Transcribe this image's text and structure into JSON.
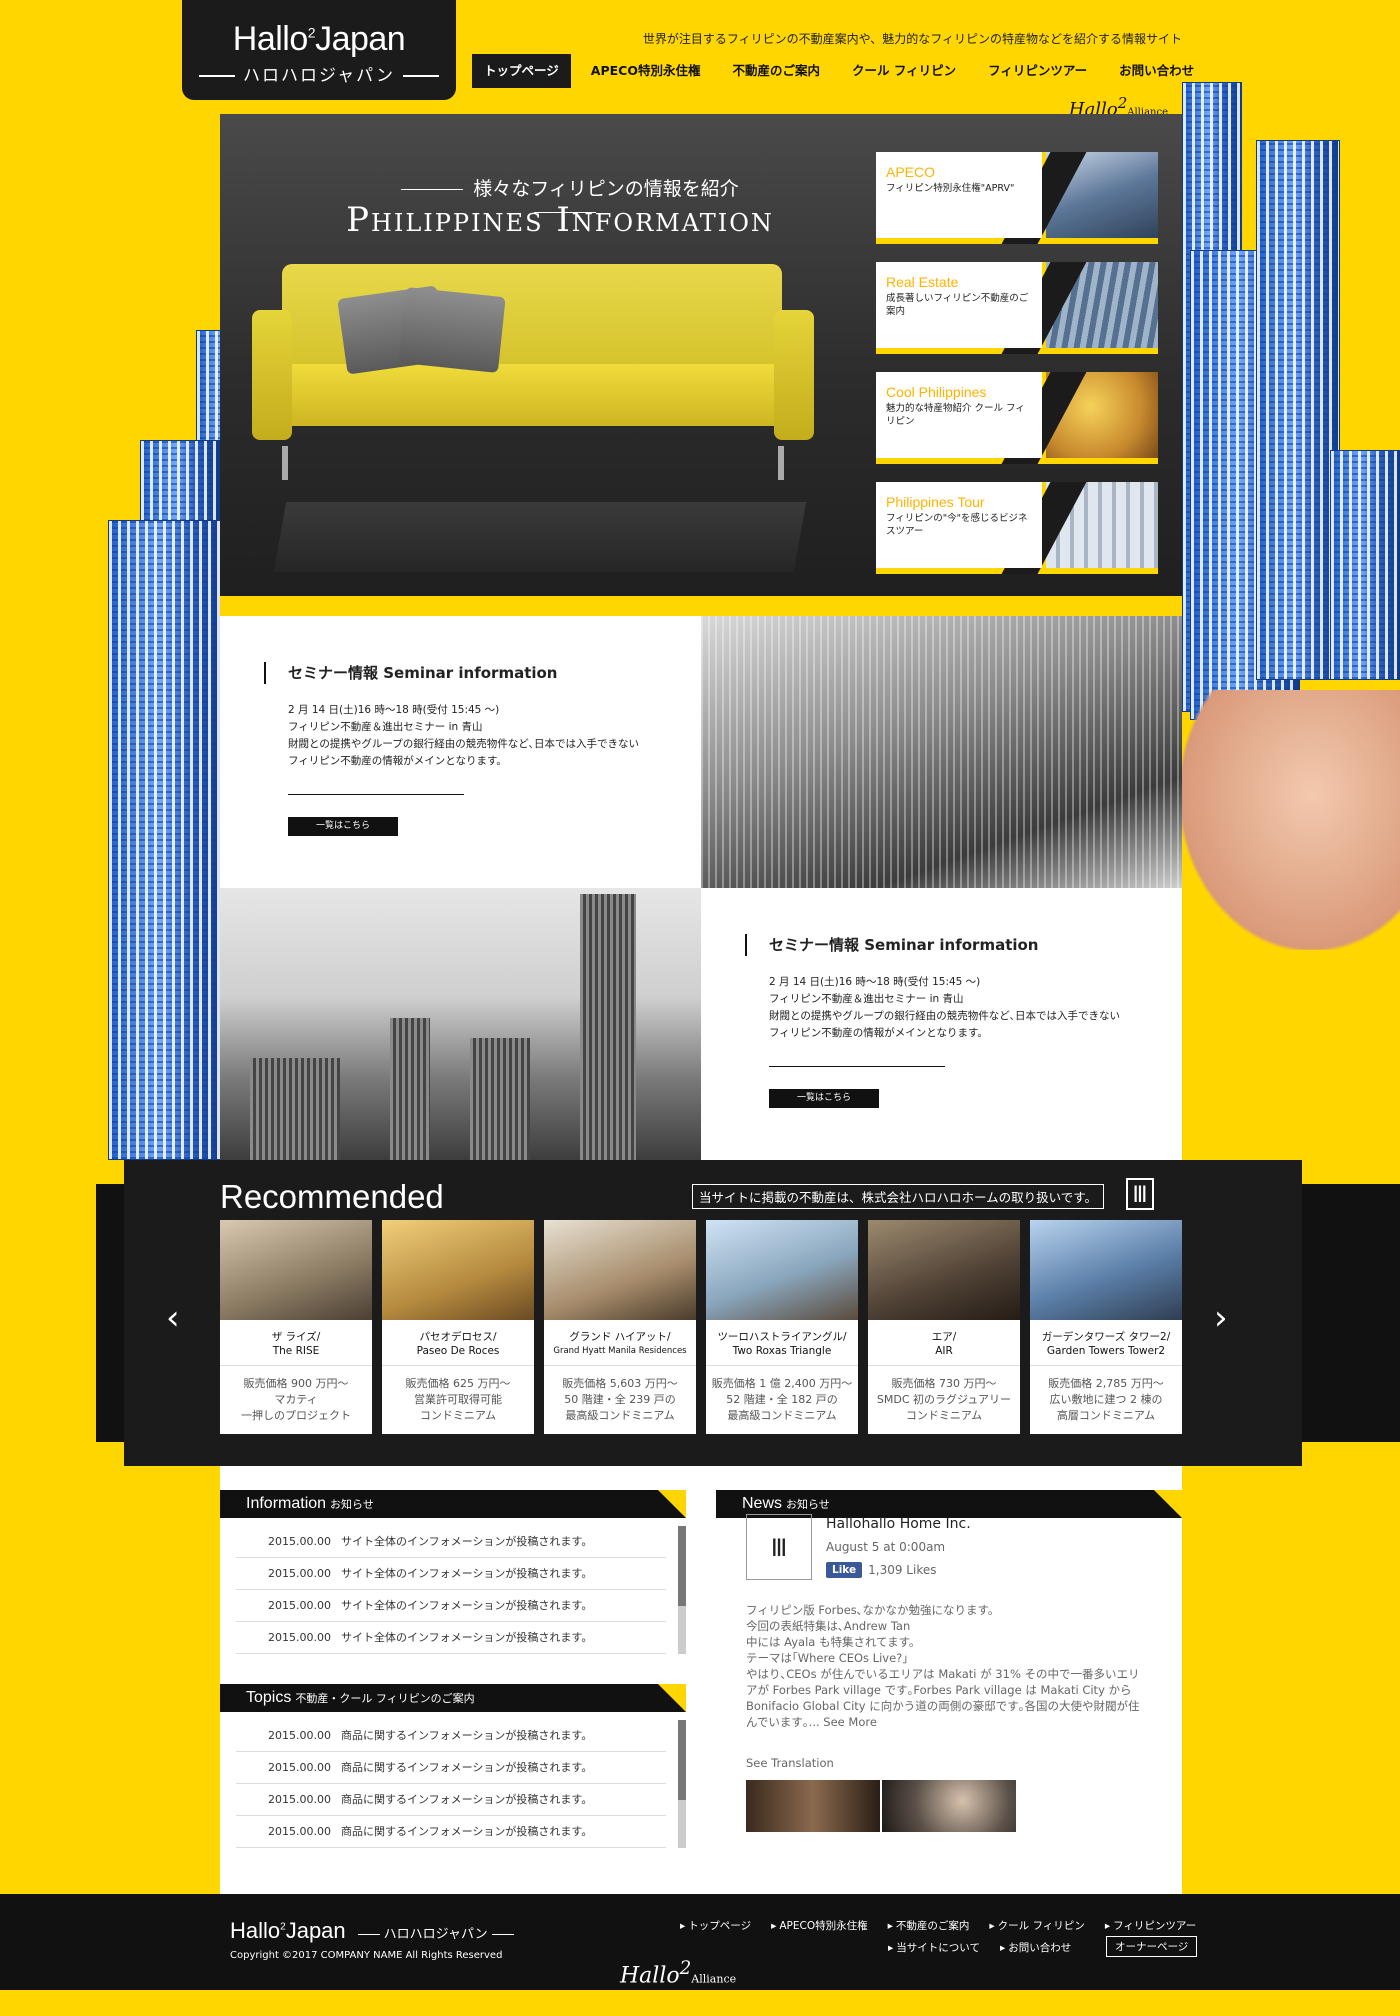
{
  "header": {
    "logo_main": "Hallo",
    "logo_sup": "2",
    "logo_rest": "Japan",
    "logo_sub": "ハロハロジャパン",
    "tagline": "世界が注目するフィリピンの不動産案内や、魅力的なフィリピンの特産物などを紹介する情報サイト",
    "nav": [
      "トップページ",
      "APECO特別永住権",
      "不動産のご案内",
      "クール フィリピン",
      "フィリピンツアー",
      "お問い合わせ"
    ],
    "alliance": "Hallo",
    "alliance_sup": "2",
    "alliance_word": "Alliance"
  },
  "hero": {
    "subtitle": "様々なフィリピンの情報を紹介",
    "title": "Philippines Information",
    "cards": [
      {
        "title": "APECO",
        "desc": "フィリピン特別永住権\"APRV\""
      },
      {
        "title": "Real Estate",
        "desc": "成長著しいフィリピン不動産のご案内"
      },
      {
        "title": "Cool Philippines",
        "desc": "魅力的な特産物紹介 クール フィリピン"
      },
      {
        "title": "Philippines Tour",
        "desc": "フィリピンの\"今\"を感じるビジネスツアー"
      }
    ]
  },
  "seminars": [
    {
      "heading": "セミナー情報 Seminar information",
      "lines": [
        "2 月 14 日(土)16 時〜18 時(受付 15:45 〜)",
        "フィリピン不動産＆進出セミナー in 青山",
        "財閥との提携やグループの銀行経由の競売物件など､日本では入手できない",
        "フィリピン不動産の情報がメインとなります。"
      ],
      "button": "一覧はこちら"
    },
    {
      "heading": "セミナー情報 Seminar information",
      "lines": [
        "2 月 14 日(土)16 時〜18 時(受付 15:45 〜)",
        "フィリピン不動産＆進出セミナー in 青山",
        "財閥との提携やグループの銀行経由の競売物件など､日本では入手できない",
        "フィリピン不動産の情報がメインとなります。"
      ],
      "button": "一覧はこちら"
    }
  ],
  "recommended": {
    "title": "Recommended",
    "note": "当サイトに掲載の不動産は、株式会社ハロハロホームの取り扱いです。",
    "prev": "‹",
    "next": "›",
    "items": [
      {
        "name1": "ザ ライズ/",
        "name2": "The RISE",
        "d1": "販売価格 900 万円〜",
        "d2": "マカティ",
        "d3": "一押しのプロジェクト"
      },
      {
        "name1": "パセオデロセス/",
        "name2": "Paseo De Roces",
        "d1": "販売価格 625 万円〜",
        "d2": "営業許可取得可能",
        "d3": "コンドミニアム"
      },
      {
        "name1": "グランド ハイアット/",
        "name2": "Grand Hyatt Manila Residences",
        "d1": "販売価格 5,603 万円〜",
        "d2": "50 階建・全 239 戸の",
        "d3": "最高級コンドミニアム"
      },
      {
        "name1": "ツーロハストライアングル/",
        "name2": "Two Roxas Triangle",
        "d1": "販売価格 1 億 2,400 万円〜",
        "d2": "52 階建・全 182 戸の",
        "d3": "最高級コンドミニアム"
      },
      {
        "name1": "エア/",
        "name2": "AIR",
        "d1": "販売価格 730 万円〜",
        "d2": "SMDC 初のラグジュアリー",
        "d3": "コンドミニアム"
      },
      {
        "name1": "ガーデンタワーズ タワー2/",
        "name2": "Garden Towers Tower2",
        "d1": "販売価格 2,785 万円〜",
        "d2": "広い敷地に建つ 2 棟の",
        "d3": "高層コンドミニアム"
      }
    ]
  },
  "information": {
    "title": "Information",
    "subtitle": "お知らせ",
    "items": [
      {
        "date": "2015.00.00",
        "text": "サイト全体のインフォメーションが投稿されます。"
      },
      {
        "date": "2015.00.00",
        "text": "サイト全体のインフォメーションが投稿されます。"
      },
      {
        "date": "2015.00.00",
        "text": "サイト全体のインフォメーションが投稿されます。"
      },
      {
        "date": "2015.00.00",
        "text": "サイト全体のインフォメーションが投稿されます。"
      }
    ]
  },
  "topics": {
    "title": "Topics",
    "subtitle": "不動産・クール フィリピンのご案内",
    "items": [
      {
        "date": "2015.00.00",
        "text": "商品に関するインフォメーションが投稿されます。"
      },
      {
        "date": "2015.00.00",
        "text": "商品に関するインフォメーションが投稿されます。"
      },
      {
        "date": "2015.00.00",
        "text": "商品に関するインフォメーションが投稿されます。"
      },
      {
        "date": "2015.00.00",
        "text": "商品に関するインフォメーションが投稿されます。"
      }
    ]
  },
  "news": {
    "title": "News",
    "subtitle": "お知らせ",
    "page_name": "Hallohallo Home Inc.",
    "date": "August 5 at 0:00am",
    "like_label": "Like",
    "likes": "1,309 Likes",
    "body": [
      "フィリピン版 Forbes､なかなか勉強になります。",
      "今回の表紙特集は､Andrew Tan",
      "中には Ayala も特集されてます。",
      "テーマは｢Where CEOs Live?｣",
      "やはり､CEOs が住んでいるエリアは Makati が 31% その中で一番多いエリ",
      "アが Forbes Park village です｡Forbes Park village は Makati City から",
      "Bonifacio Global City に向かう道の両側の豪邸です｡各国の大使や財閥が住",
      "んでいます｡... See More"
    ],
    "see_translation": "See Translation"
  },
  "footer": {
    "logo_main": "Hallo",
    "logo_sup": "2",
    "logo_rest": "Japan",
    "logo_sub": "ハロハロジャパン",
    "copyright": "Copyright ©2017 COMPANY NAME All Rights Reserved",
    "nav_row1": [
      "トップページ",
      "APECO特別永住権",
      "不動産のご案内",
      "クール フィリピン",
      "フィリピンツアー"
    ],
    "nav_row2": [
      "当サイトについて",
      "お問い合わせ"
    ],
    "owner": "オーナーページ",
    "alliance": "Hallo",
    "alliance_sup": "2",
    "alliance_word": "Alliance"
  },
  "colors": {
    "accent": "#ffd600",
    "dark": "#1b1b1b",
    "card_title": "#ffb300",
    "facebook": "#3b5998"
  }
}
